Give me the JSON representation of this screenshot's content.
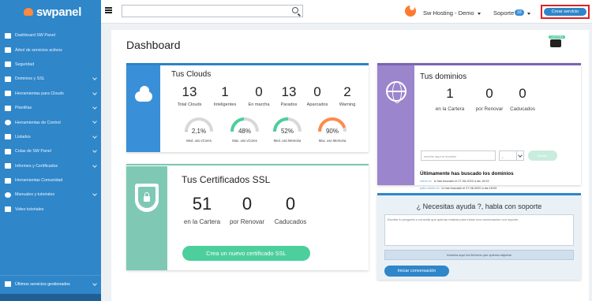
{
  "brand": {
    "name": "swpanel"
  },
  "sidebar": {
    "items": [
      {
        "label": "Dashboard SW Panel",
        "icon": "dashboard-icon",
        "chevron": false
      },
      {
        "label": "Árbol de servicios activos",
        "icon": "tree-icon",
        "chevron": false
      },
      {
        "label": "Seguridad",
        "icon": "shield-icon",
        "chevron": false
      },
      {
        "label": "Dominios y SSL",
        "icon": "globe-icon",
        "chevron": true
      },
      {
        "label": "Herramientas para Clouds",
        "icon": "toolbox-icon",
        "chevron": true
      },
      {
        "label": "Plantillas",
        "icon": "file-icon",
        "chevron": true
      },
      {
        "label": "Herramientas de Control",
        "icon": "check-circle-icon",
        "chevron": true
      },
      {
        "label": "Listados",
        "icon": "list-icon",
        "chevron": true
      },
      {
        "label": "Colas de SW Panel",
        "icon": "layers-icon",
        "chevron": true
      },
      {
        "label": "Informes y Certificados",
        "icon": "report-icon",
        "chevron": true
      },
      {
        "label": "Herramientas Comunidad",
        "icon": "community-icon",
        "chevron": false
      },
      {
        "label": "Manuales y tutoriales",
        "icon": "help-icon",
        "chevron": true
      },
      {
        "label": "Video tutoriales",
        "icon": "video-icon",
        "chevron": false
      }
    ],
    "bottom": {
      "label": "Últimos servicios gestionados"
    }
  },
  "topbar": {
    "search_placeholder": "",
    "account": "Sw Hosting - Demo",
    "support": "Soporte",
    "support_badge": "16",
    "create_button": "Crear servicio"
  },
  "dashboard": {
    "title": "Dashboard",
    "wallet_label": "CARTERA"
  },
  "clouds": {
    "title": "Tus Clouds",
    "stats": [
      {
        "value": "13",
        "label": "Total Clouds"
      },
      {
        "value": "1",
        "label": "Inteligentes"
      },
      {
        "value": "0",
        "label": "En marcha"
      },
      {
        "value": "13",
        "label": "Parados"
      },
      {
        "value": "0",
        "label": "Aparcados"
      },
      {
        "value": "2",
        "label": "Warning"
      }
    ],
    "gauges": [
      {
        "value": "2,1%",
        "level": 0.021,
        "color": "#b7b7b7",
        "label": "Med. uso vCores"
      },
      {
        "value": "48%",
        "level": 0.48,
        "color": "#4ccf9c",
        "label": "Max. uso vCores"
      },
      {
        "value": "52%",
        "level": 0.52,
        "color": "#4ccf9c",
        "label": "Med. uso Memoria"
      },
      {
        "value": "90%",
        "level": 0.9,
        "color": "#ff8a4c",
        "label": "Max. uso Memoria"
      }
    ]
  },
  "ssl": {
    "title": "Tus Certificados SSL",
    "stats": [
      {
        "value": "51",
        "label": "en la Cartera"
      },
      {
        "value": "0",
        "label": "por Renovar"
      },
      {
        "value": "0",
        "label": "Caducados"
      }
    ],
    "button": "Crea un nuevo certificado SSL"
  },
  "domains": {
    "title": "Tus dominios",
    "stats": [
      {
        "value": "1",
        "label": "en la Cartera"
      },
      {
        "value": "0",
        "label": "por Renovar"
      },
      {
        "value": "0",
        "label": "Caducados"
      }
    ],
    "input_placeholder": "escribe aquí el dominio",
    "select_value": ".",
    "search_button": "Buscar",
    "recent_title": "Últimamente has buscado los dominios",
    "recent": [
      {
        "domain": "sitelio.es",
        "text": "lo has buscado el 27-06-2020 a las 19:03"
      },
      {
        "domain": "pabo-sitelio.es",
        "text": "lo has buscado el 27-06-2020 a las 18:53"
      },
      {
        "domain": "hola-hola.es",
        "text": "lo has buscado el 25-06-2020 a las 10:10"
      },
      {
        "domain": "masterdon.com",
        "text": "lo has buscado el 11-06-2020 a las 13:40"
      }
    ]
  },
  "help": {
    "title": "¿ Necesitas ayuda ?, habla con soporte",
    "textarea_placeholder": "Escribe tu pregunta o consulta que quieras realizar para iniciar una conversación con soporte",
    "attach": "Arrastra aquí los ficheros que quieras adjuntar",
    "button": "Iniciar conversación"
  }
}
